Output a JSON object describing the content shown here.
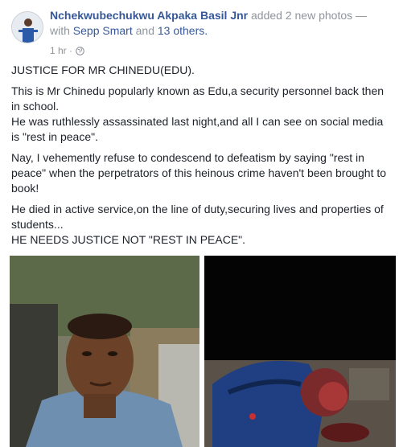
{
  "post": {
    "author": "Nchekwubechukwu Akpaka Basil Jnr",
    "action": "added 2 new photos —",
    "with_prefix": "with",
    "tagged_person": "Sepp Smart",
    "and_text": "and",
    "others": "13 others.",
    "timestamp": "1 hr ·",
    "privacy_icon": "globe-icon",
    "body": [
      "JUSTICE FOR MR CHINEDU(EDU).",
      "This is Mr Chinedu popularly known as Edu,a security personnel back then\nin school.\nHe was ruthlessly assassinated last night,and all I can see on social media\nis \"rest in peace\".",
      "Nay, I vehemently refuse to condescend to defeatism by saying \"rest in\npeace\" when the perpetrators of this heinous crime haven't been brought to\nbook!",
      "He died in active service,on the line of duty,securing lives and properties of\nstudents...\nHE NEEDS JUSTICE NOT \"REST IN PEACE\"."
    ]
  },
  "colors": {
    "link": "#365899",
    "muted": "#90949c",
    "text": "#1d2129"
  }
}
